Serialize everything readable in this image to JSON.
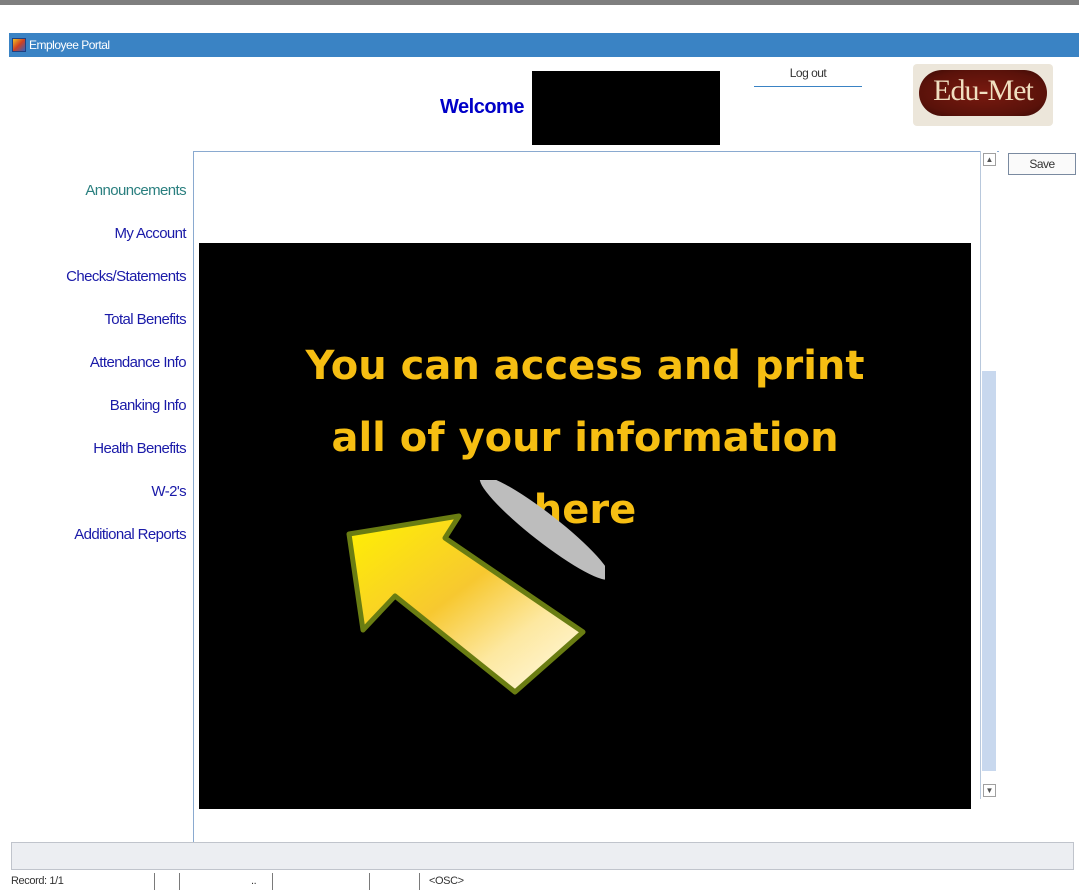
{
  "window": {
    "title": "Employee Portal",
    "icon": "app-icon"
  },
  "header": {
    "welcome": "Welcome",
    "logout_label": "Log out",
    "logo_text": "Edu-Met"
  },
  "sidebar": {
    "items": [
      {
        "label": "Announcements"
      },
      {
        "label": "My Account"
      },
      {
        "label": "Checks/Statements"
      },
      {
        "label": "Total Benefits"
      },
      {
        "label": "Attendance Info"
      },
      {
        "label": "Banking Info"
      },
      {
        "label": "Health Benefits"
      },
      {
        "label": "W-2's"
      },
      {
        "label": "Additional Reports"
      }
    ]
  },
  "toolbar": {
    "save_label": "Save"
  },
  "callout": {
    "line1": "You can access and print",
    "line2": "all of your information",
    "line3": "here"
  },
  "status": {
    "record": "Record: 1/1",
    "dots": "..",
    "mode": "<OSC>"
  },
  "colors": {
    "titlebar": "#3a83c4",
    "link": "#1a1aa8",
    "callout_text": "#f6be12",
    "welcome": "#0000c8"
  }
}
